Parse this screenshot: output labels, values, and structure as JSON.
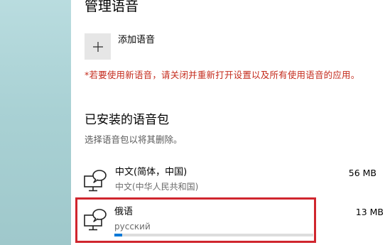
{
  "section_title": "管理语音",
  "add_voice": {
    "icon": "plus-icon",
    "label": "添加语音"
  },
  "warning": "*若要使用新语音，请关闭并重新打开设置以及所有使用语音的应用。",
  "installed": {
    "title": "已安装的语音包",
    "hint": "选择语音包以将其删除。",
    "packs": [
      {
        "icon": "speech-display-icon",
        "name": "中文(简体，中国)",
        "subtitle": "中文(中华人民共和国)",
        "size": "56 MB"
      },
      {
        "icon": "speech-display-icon",
        "name": "俄语",
        "subtitle": "русский",
        "size": "13 MB",
        "selected": true,
        "download_progress": 0.04
      }
    ]
  },
  "colors": {
    "warning": "#c42b1c",
    "accent": "#0078d7",
    "selection_outline": "#d0262e"
  }
}
